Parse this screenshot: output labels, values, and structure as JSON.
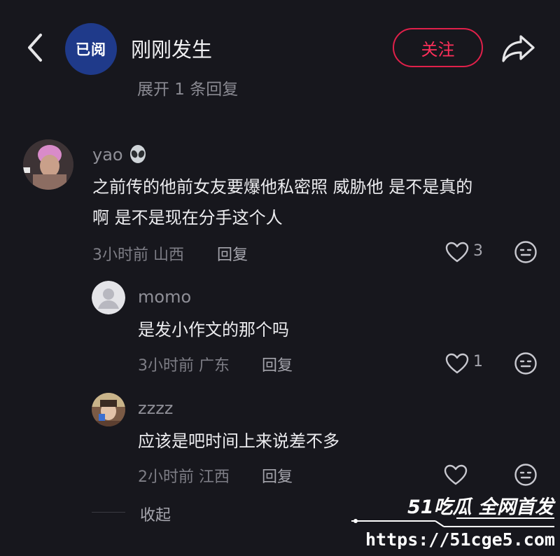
{
  "header": {
    "account_avatar_text": "已阅",
    "account_name": "刚刚发生",
    "follow_label": "关注"
  },
  "cut_text": "展开 1 条回复",
  "comments": [
    {
      "username": "yao",
      "emoji": "👽",
      "text_line1": "之前传的他前女友要爆他私密照 威胁他 是不是真的",
      "text_line2": "啊 是不是现在分手这个人",
      "time": "3小时前",
      "location": "山西",
      "reply_label": "回复",
      "likes": "3"
    },
    {
      "username": "momo",
      "text": "是发小作文的那个吗",
      "time": "3小时前",
      "location": "广东",
      "reply_label": "回复",
      "likes": "1"
    },
    {
      "username": "zzzz",
      "text": "应该是吧时间上来说差不多",
      "time": "2小时前",
      "location": "江西",
      "reply_label": "回复",
      "likes": ""
    }
  ],
  "collapse_label": "收起",
  "watermark": {
    "brand": "51吃瓜 全网首发",
    "url": "https://51cge5.com"
  },
  "colors": {
    "background": "#17171d",
    "follow_accent": "#e0204a",
    "avatar_blue": "#1f3a8a"
  },
  "icons": [
    "back-icon",
    "share-icon",
    "heart-icon",
    "emoji-face-icon"
  ]
}
